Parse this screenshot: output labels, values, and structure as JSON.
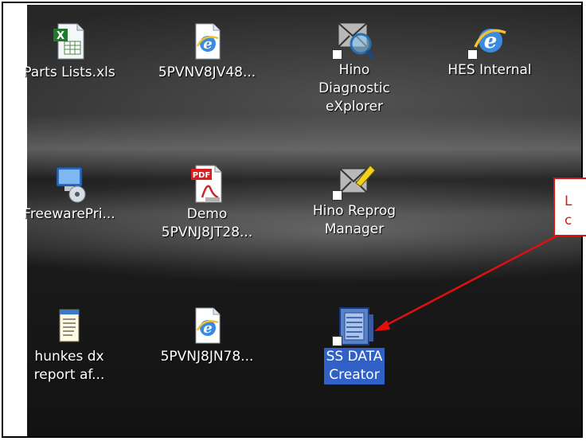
{
  "desktop": {
    "icons": [
      {
        "label": "Parts Lists.xls",
        "icon": "excel-file-icon"
      },
      {
        "label": "5PVNV8JV48...",
        "icon": "internet-explorer-icon"
      },
      {
        "label": "Hino Diagnostic eXplorer",
        "line1": "Hino Diagnostic",
        "line2": "eXplorer",
        "icon": "diagnostic-explorer-icon"
      },
      {
        "label": "HES Internal",
        "icon": "internet-explorer-icon"
      },
      {
        "label": "FreewarePri...",
        "icon": "computer-cd-icon"
      },
      {
        "label": "Demo 5PVNJ8JT28...",
        "line1": "Demo",
        "line2": "5PVNJ8JT28...",
        "icon": "pdf-file-icon"
      },
      {
        "label": "Hino Reprog Manager",
        "line1": "Hino Reprog",
        "line2": "Manager",
        "icon": "reprog-manager-icon"
      },
      {
        "label": "hunkes dx report af...",
        "line1": "hunkes dx",
        "line2": "report af...",
        "icon": "notepad-file-icon"
      },
      {
        "label": "5PVNJ8JN78...",
        "icon": "internet-explorer-icon"
      },
      {
        "label": "SS DATA Creator",
        "line1": "SS DATA",
        "line2": "Creator",
        "icon": "ss-data-creator-icon",
        "selected": true
      }
    ]
  },
  "callout": {
    "line1": "L",
    "line2": "c"
  },
  "colors": {
    "selection": "#3160c6",
    "callout_red": "#e01010"
  }
}
